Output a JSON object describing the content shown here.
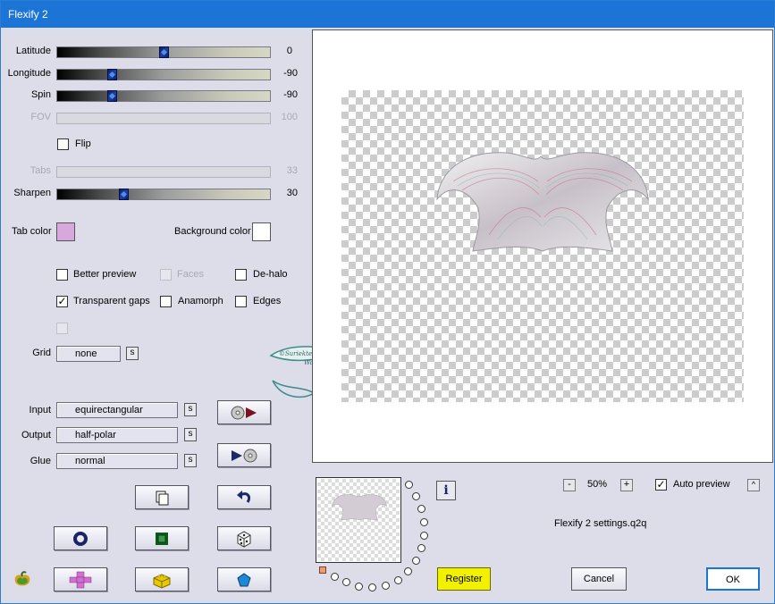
{
  "window": {
    "title": "Flexify 2"
  },
  "sliders": [
    {
      "label": "Latitude",
      "value": "0",
      "level": 0.5,
      "disabled": false
    },
    {
      "label": "Longitude",
      "value": "-90",
      "level": 0.25,
      "disabled": false
    },
    {
      "label": "Spin",
      "value": "-90",
      "level": 0.25,
      "disabled": false
    },
    {
      "label": "FOV",
      "value": "100",
      "disabled": true
    },
    {
      "label": "Tabs",
      "value": "33",
      "disabled": true
    },
    {
      "label": "Sharpen",
      "value": "30",
      "level": 0.3,
      "disabled": false
    }
  ],
  "flip": {
    "label": "Flip",
    "checked": false
  },
  "colors": {
    "tab_label": "Tab color",
    "tab_color": "#d8a8dc",
    "bg_label": "Background color",
    "bg_color": "#ffffff"
  },
  "options": {
    "better_preview": {
      "label": "Better preview",
      "checked": false
    },
    "faces": {
      "label": "Faces",
      "checked": false,
      "disabled": true
    },
    "de_halo": {
      "label": "De-halo",
      "checked": false
    },
    "transparent_gaps": {
      "label": "Transparent gaps",
      "checked": true
    },
    "anamorph": {
      "label": "Anamorph",
      "checked": false
    },
    "edges": {
      "label": "Edges",
      "checked": false
    }
  },
  "grid": {
    "label": "Grid",
    "value": "none",
    "s_label": "s"
  },
  "input": {
    "label": "Input",
    "value": "equirectangular",
    "s_label": "s"
  },
  "output": {
    "label": "Output",
    "value": "half-polar",
    "s_label": "s"
  },
  "glue": {
    "label": "Glue",
    "value": "normal",
    "s_label": "s"
  },
  "watermark": {
    "text": "©Suriekteratan Wass"
  },
  "zoom": {
    "minus": "-",
    "value": "50%",
    "plus": "+"
  },
  "auto_preview": {
    "label": "Auto preview",
    "checked": true,
    "arrow": "^"
  },
  "settings_file": "Flexify 2 settings.q2q",
  "buttons": {
    "register": "Register",
    "cancel": "Cancel",
    "ok": "OK",
    "info": "i"
  },
  "icons": {
    "accent": "#e8e800",
    "brand": "#1c74d6"
  }
}
